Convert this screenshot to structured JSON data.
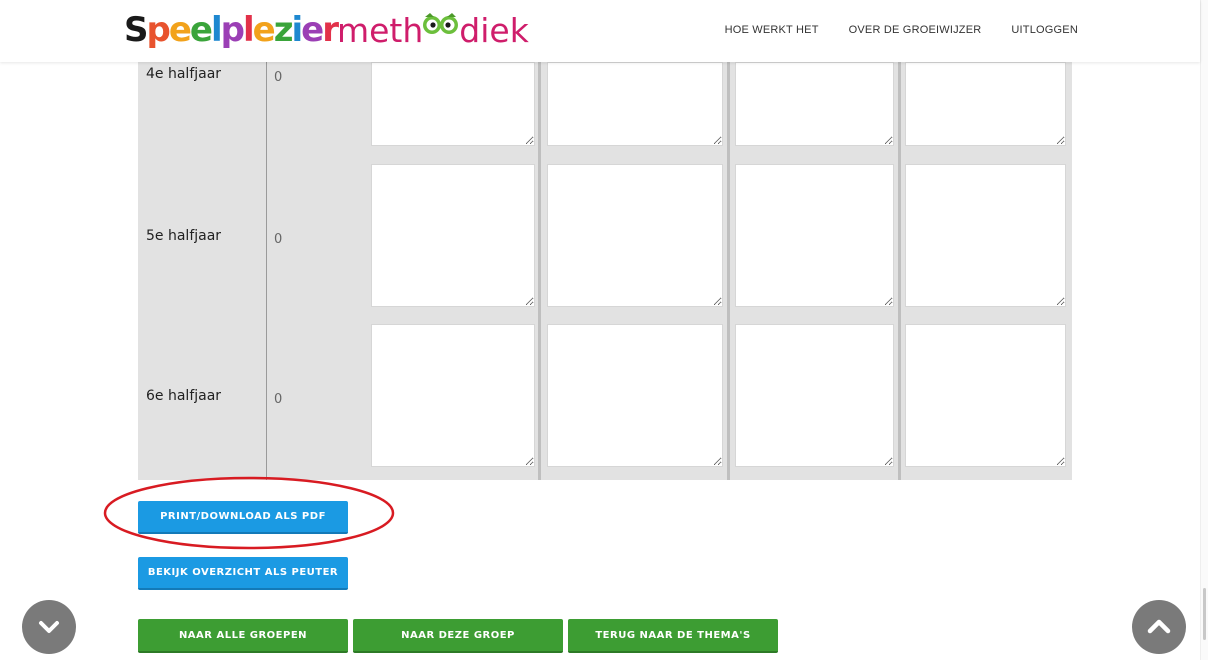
{
  "header": {
    "logo_left": "Speelplezier",
    "logo_right_a": "meth",
    "logo_right_b": "diek",
    "nav": [
      "HOE WERKT HET",
      "OVER DE GROEIWIJZER",
      "UITLOGGEN"
    ]
  },
  "table": {
    "rows": [
      {
        "label": "4e halfjaar",
        "score": "0"
      },
      {
        "label": "5e halfjaar",
        "score": "0"
      },
      {
        "label": "6e halfjaar",
        "score": "0"
      }
    ]
  },
  "buttons": {
    "print_pdf": "PRINT/DOWNLOAD ALS PDF",
    "overview_peuter": "BEKIJK OVERZICHT ALS PEUTER",
    "all_groups": "NAAR ALLE GROEPEN",
    "this_group": "NAAR DEZE GROEP",
    "back_themes": "TERUG NAAR DE THEMA'S"
  },
  "icons": {
    "scroll_down": "chevron-down-icon",
    "scroll_up": "chevron-up-icon"
  },
  "colors": {
    "blue_button": "#1b9ae3",
    "green_button": "#3d9d33",
    "annotation": "#d81b22",
    "logo_pink": "#cf1d6b"
  }
}
